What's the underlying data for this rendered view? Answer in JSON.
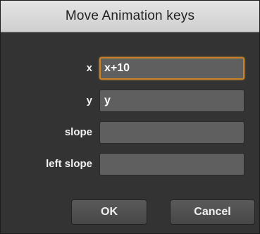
{
  "window": {
    "title": "Move Animation keys"
  },
  "form": {
    "fields": [
      {
        "label": "x",
        "value": "x+10"
      },
      {
        "label": "y",
        "value": "y"
      },
      {
        "label": "slope",
        "value": ""
      },
      {
        "label": "left slope",
        "value": ""
      }
    ]
  },
  "buttons": {
    "ok_label": "OK",
    "cancel_label": "Cancel"
  },
  "colors": {
    "focus_ring": "#c8822a",
    "dialog_background": "#333333",
    "field_background": "#5f5f5f"
  }
}
